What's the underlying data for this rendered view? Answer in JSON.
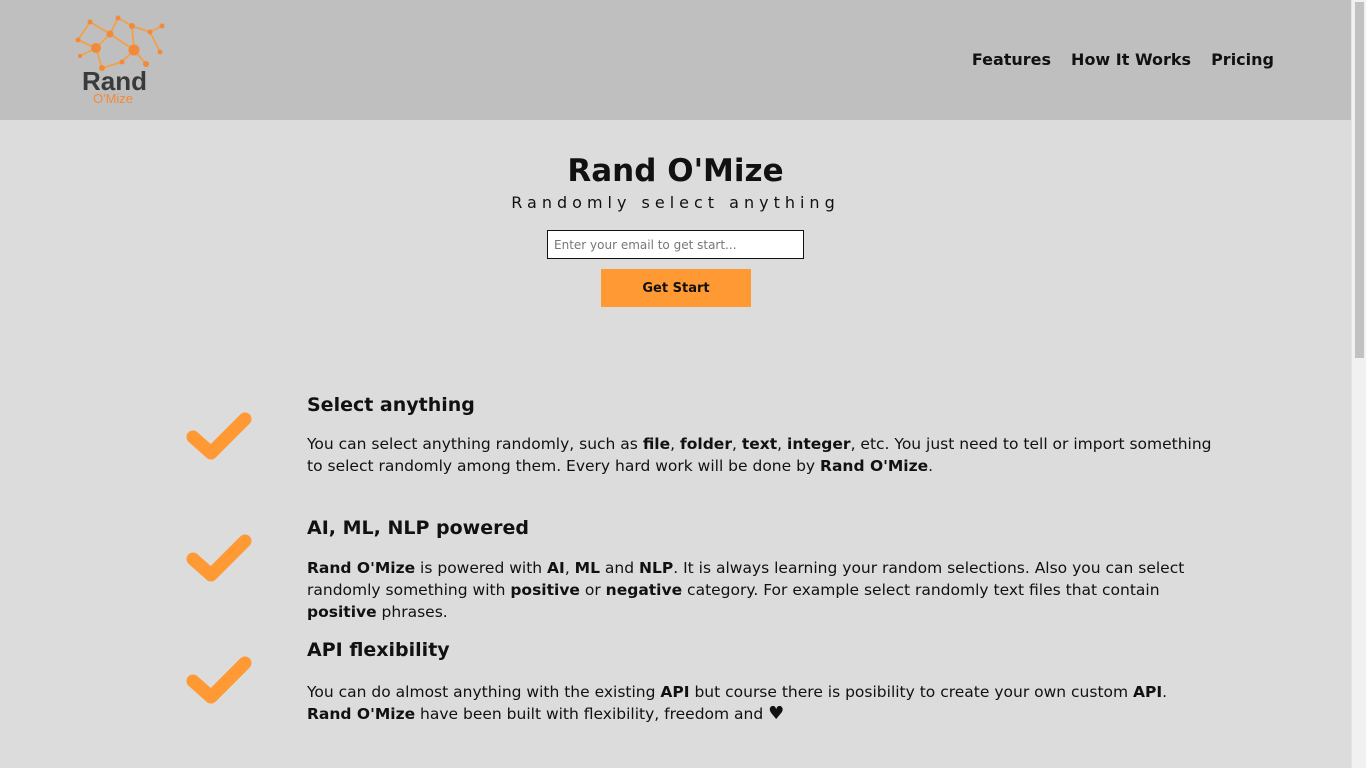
{
  "header": {
    "logo": {
      "word1": "Rand",
      "word2": "O'Mize"
    },
    "nav": [
      "Features",
      "How It Works",
      "Pricing"
    ]
  },
  "hero": {
    "title": "Rand O'Mize",
    "subtitle": "Randomly select anything",
    "email_placeholder": "Enter your email to get start...",
    "button_label": "Get Start"
  },
  "features": [
    {
      "title": "Select anything",
      "body": [
        {
          "t": "You can select anything randomly, such as "
        },
        {
          "b": "file"
        },
        {
          "t": ", "
        },
        {
          "b": "folder"
        },
        {
          "t": ", "
        },
        {
          "b": "text"
        },
        {
          "t": ", "
        },
        {
          "b": "integer"
        },
        {
          "t": ", etc. You just need to tell or import something to select randomly among them. Every hard work will be done by "
        },
        {
          "b": "Rand O'Mize"
        },
        {
          "t": "."
        }
      ]
    },
    {
      "title": "AI, ML, NLP powered",
      "body": [
        {
          "b": "Rand O'Mize"
        },
        {
          "t": " is powered with "
        },
        {
          "b": "AI"
        },
        {
          "t": ", "
        },
        {
          "b": "ML"
        },
        {
          "t": " and "
        },
        {
          "b": "NLP"
        },
        {
          "t": ". It is always learning your random selections. Also you can select randomly something with "
        },
        {
          "b": "positive"
        },
        {
          "t": " or "
        },
        {
          "b": "negative"
        },
        {
          "t": " category. For example select randomly text files that contain "
        },
        {
          "b": "positive"
        },
        {
          "t": " phrases."
        }
      ]
    },
    {
      "title": "API flexibility",
      "body": [
        {
          "t": "You can do almost anything with the existing "
        },
        {
          "b": "API"
        },
        {
          "t": " but course there is posibility to create your own custom "
        },
        {
          "b": "API"
        },
        {
          "t": ". "
        },
        {
          "b": "Rand O'Mize"
        },
        {
          "t": " have been built with flexibility, freedom and "
        },
        {
          "heart": "♥"
        }
      ]
    }
  ],
  "colors": {
    "accent": "#ff9933",
    "header_bg": "#bfbfbf",
    "page_bg": "#dcdcdc",
    "logo_orange": "#f28a3a"
  },
  "icons": {
    "feature_icon": "check-icon",
    "logo_icon": "network-icon",
    "heart": "heart-icon"
  }
}
